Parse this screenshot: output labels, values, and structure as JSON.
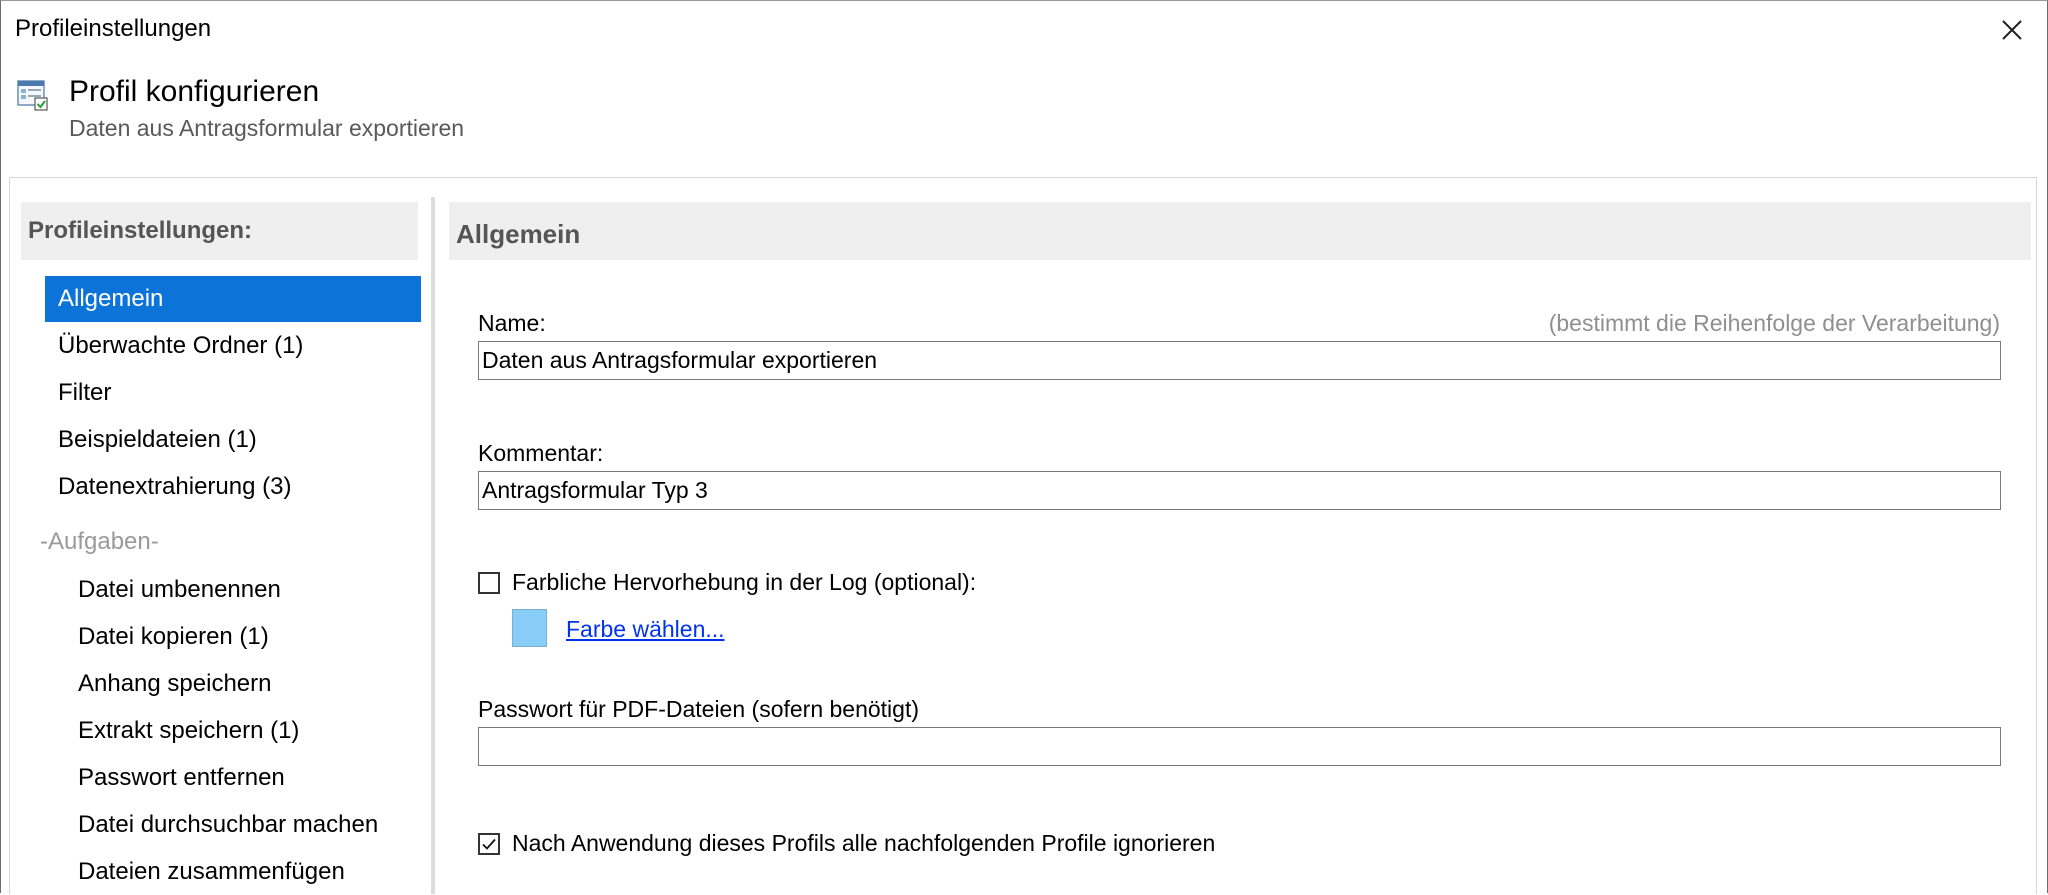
{
  "window": {
    "title": "Profileinstellungen"
  },
  "header": {
    "title": "Profil konfigurieren",
    "subtitle": "Daten aus Antragsformular exportieren",
    "icon": "profile-settings-icon"
  },
  "sidebar": {
    "header": "Profileinstellungen:",
    "items": [
      {
        "label": "Allgemein",
        "selected": true
      },
      {
        "label": "Überwachte Ordner (1)"
      },
      {
        "label": "Filter"
      },
      {
        "label": "Beispieldateien (1)"
      },
      {
        "label": "Datenextrahierung (3)"
      }
    ],
    "group_label": "-Aufgaben-",
    "tasks": [
      {
        "label": "Datei umbenennen"
      },
      {
        "label": "Datei kopieren (1)"
      },
      {
        "label": "Anhang speichern"
      },
      {
        "label": "Extrakt speichern (1)"
      },
      {
        "label": "Passwort entfernen"
      },
      {
        "label": "Datei durchsuchbar machen"
      },
      {
        "label": "Dateien zusammenfügen"
      }
    ]
  },
  "main": {
    "section_title": "Allgemein",
    "name_label": "Name:",
    "name_hint": "(bestimmt die Reihenfolge der Verarbeitung)",
    "name_value": "Daten aus Antragsformular exportieren",
    "comment_label": "Kommentar:",
    "comment_value": "Antragsformular Typ 3",
    "highlight_label": "Farbliche Hervorhebung in der Log (optional):",
    "highlight_checked": false,
    "color_link": "Farbe wählen...",
    "color_value": "#88ccf8",
    "password_label": "Passwort für PDF-Dateien (sofern benötigt)",
    "password_value": "",
    "ignore_label": "Nach Anwendung dieses Profils alle nachfolgenden Profile ignorieren",
    "ignore_checked": true
  },
  "colors": {
    "accent": "#0c74d9",
    "panel_header": "#efefef",
    "link": "#0033ee"
  }
}
